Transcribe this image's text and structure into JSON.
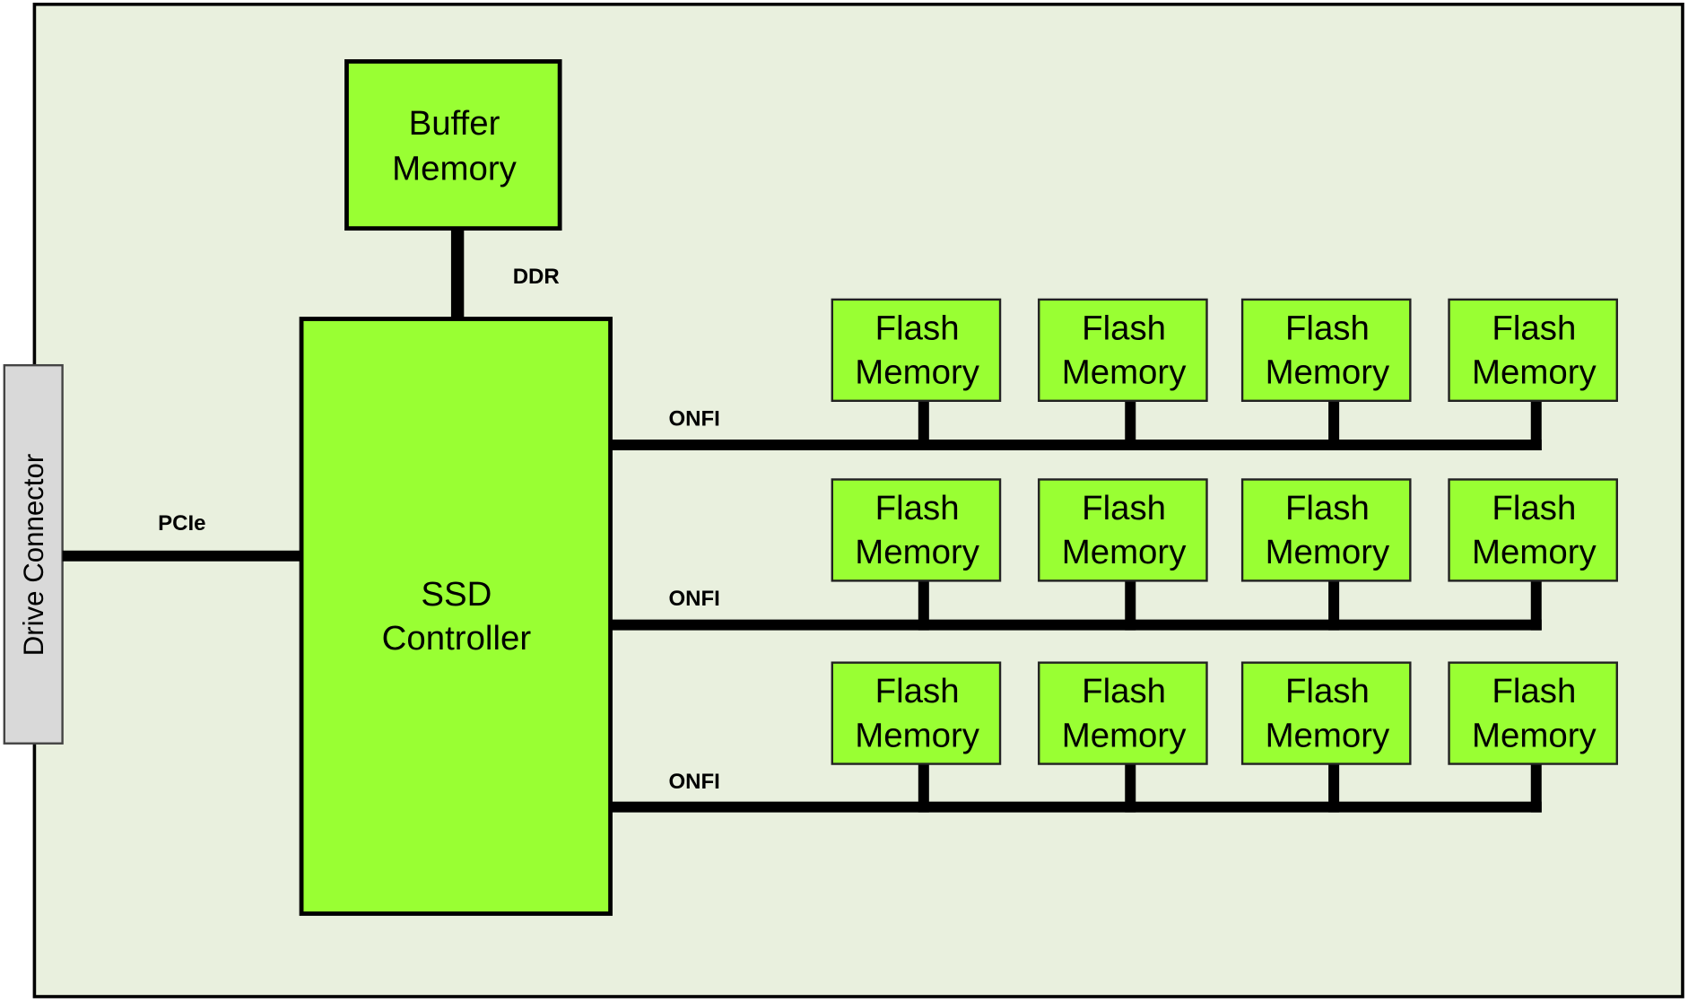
{
  "colors": {
    "board": "#e9f0de",
    "component": "#99ff33",
    "connector": "#d9d9d9",
    "line": "#000000"
  },
  "drive_connector": {
    "label": "Drive Connector"
  },
  "buffer_memory": {
    "line1": "Buffer",
    "line2": "Memory"
  },
  "ssd_controller": {
    "line1": "SSD",
    "line2": "Controller"
  },
  "links": {
    "ddr": "DDR",
    "pcie": "PCIe"
  },
  "channels": [
    {
      "label": "ONFI",
      "chips": [
        {
          "line1": "Flash",
          "line2": "Memory"
        },
        {
          "line1": "Flash",
          "line2": "Memory"
        },
        {
          "line1": "Flash",
          "line2": "Memory"
        },
        {
          "line1": "Flash",
          "line2": "Memory"
        }
      ]
    },
    {
      "label": "ONFI",
      "chips": [
        {
          "line1": "Flash",
          "line2": "Memory"
        },
        {
          "line1": "Flash",
          "line2": "Memory"
        },
        {
          "line1": "Flash",
          "line2": "Memory"
        },
        {
          "line1": "Flash",
          "line2": "Memory"
        }
      ]
    },
    {
      "label": "ONFI",
      "chips": [
        {
          "line1": "Flash",
          "line2": "Memory"
        },
        {
          "line1": "Flash",
          "line2": "Memory"
        },
        {
          "line1": "Flash",
          "line2": "Memory"
        },
        {
          "line1": "Flash",
          "line2": "Memory"
        }
      ]
    }
  ]
}
